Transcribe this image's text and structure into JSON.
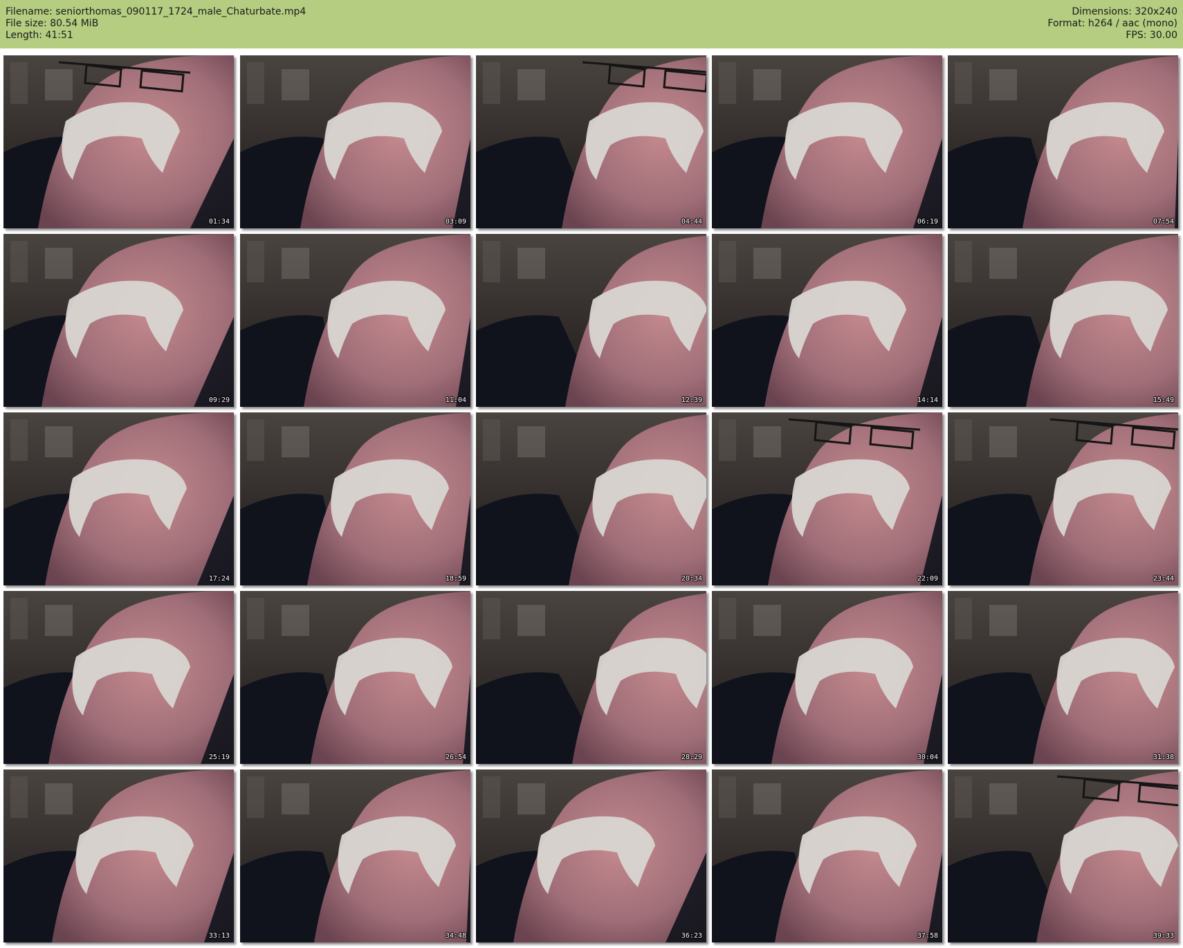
{
  "info": {
    "filename": "Filename: seniorthomas_090117_1724_male_Chaturbate.mp4",
    "file_size": "File size: 80.54 MiB",
    "length": "Length: 41:51",
    "dimensions": "Dimensions: 320x240",
    "format": "Format: h264 / aac (mono)",
    "fps": "FPS: 30.00"
  },
  "thumbnails": [
    {
      "time": "01:34"
    },
    {
      "time": "03:09"
    },
    {
      "time": "04:44"
    },
    {
      "time": "06:19"
    },
    {
      "time": "07:54"
    },
    {
      "time": "09:29"
    },
    {
      "time": "11:04"
    },
    {
      "time": "12:39"
    },
    {
      "time": "14:14"
    },
    {
      "time": "15:49"
    },
    {
      "time": "17:24"
    },
    {
      "time": "18:59"
    },
    {
      "time": "20:34"
    },
    {
      "time": "22:09"
    },
    {
      "time": "23:44"
    },
    {
      "time": "25:19"
    },
    {
      "time": "26:54"
    },
    {
      "time": "28:29"
    },
    {
      "time": "30:04"
    },
    {
      "time": "31:38"
    },
    {
      "time": "33:13"
    },
    {
      "time": "34:48"
    },
    {
      "time": "36:23"
    },
    {
      "time": "37:58"
    },
    {
      "time": "39:33"
    }
  ],
  "colors": {
    "header_bg": "#b4cd81",
    "skin": "#a06e78",
    "beard": "#d9d6d2",
    "robe": "#10131c",
    "background_scene": "#3a3430"
  }
}
